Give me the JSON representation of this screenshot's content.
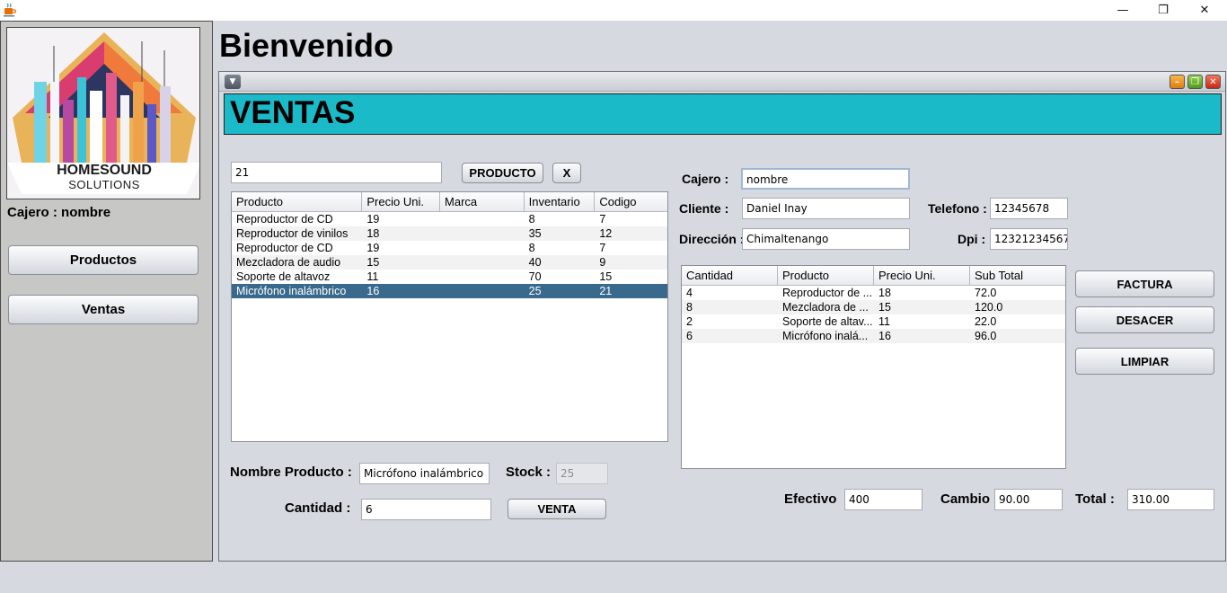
{
  "sidebar": {
    "logo_line1": "HOMESOUND",
    "logo_line2": "SOLUTIONS",
    "cajero_label": "Cajero :",
    "cajero_name": "nombre",
    "btn_productos": "Productos",
    "btn_ventas": "Ventas"
  },
  "header": {
    "title": "Bienvenido"
  },
  "ventas": {
    "title": "VENTAS",
    "search_value": "21",
    "btn_producto": "PRODUCTO",
    "btn_clear": "X",
    "products_table": {
      "columns": [
        "Producto",
        "Precio Uni.",
        "Marca",
        "Inventario",
        "Codigo"
      ],
      "rows": [
        [
          "Reproductor de CD",
          "19",
          "",
          "8",
          "7"
        ],
        [
          "Reproductor de vinilos",
          "18",
          "",
          "35",
          "12"
        ],
        [
          "Reproductor de CD",
          "19",
          "",
          "8",
          "7"
        ],
        [
          "Mezcladora de audio",
          "15",
          "",
          "40",
          "9"
        ],
        [
          "Soporte de altavoz",
          "11",
          "",
          "70",
          "15"
        ],
        [
          "Micrófono inalámbrico",
          "16",
          "",
          "25",
          "21"
        ]
      ]
    },
    "nombre_producto_label": "Nombre Producto :",
    "nombre_producto_value": "Micrófono inalámbrico",
    "stock_label": "Stock :",
    "stock_value": "25",
    "cantidad_label": "Cantidad :",
    "cantidad_value": "6",
    "btn_venta": "VENTA",
    "cajero_label": "Cajero :",
    "cajero_value": "nombre",
    "cliente_label": "Cliente :",
    "cliente_value": "Daniel Inay",
    "telefono_label": "Telefono :",
    "telefono_value": "12345678",
    "direccion_label": "Dirección :",
    "direccion_value": "Chimaltenango",
    "dpi_label": "Dpi :",
    "dpi_value": "12321234567",
    "cart_table": {
      "columns": [
        "Cantidad",
        "Producto",
        "Precio Uni.",
        "Sub Total"
      ],
      "rows": [
        [
          "4",
          "Reproductor de ...",
          "18",
          "72.0"
        ],
        [
          "8",
          "Mezcladora de ...",
          "15",
          "120.0"
        ],
        [
          "2",
          "Soporte de altav...",
          "11",
          "22.0"
        ],
        [
          "6",
          "Micrófono inalá...",
          "16",
          "96.0"
        ]
      ]
    },
    "btn_factura": "FACTURA",
    "btn_desacer": "DESACER",
    "btn_limpiar": "LIMPIAR",
    "efectivo_label": "Efectivo",
    "efectivo_value": "400",
    "cambio_label": "Cambio",
    "cambio_value": "90.00",
    "total_label": "Total :",
    "total_value": "310.00"
  },
  "colors": {
    "banner": "#1bbac9",
    "selected_row": "#39698c",
    "sidebar": "#c7c7c5",
    "background": "#d6d9df"
  }
}
